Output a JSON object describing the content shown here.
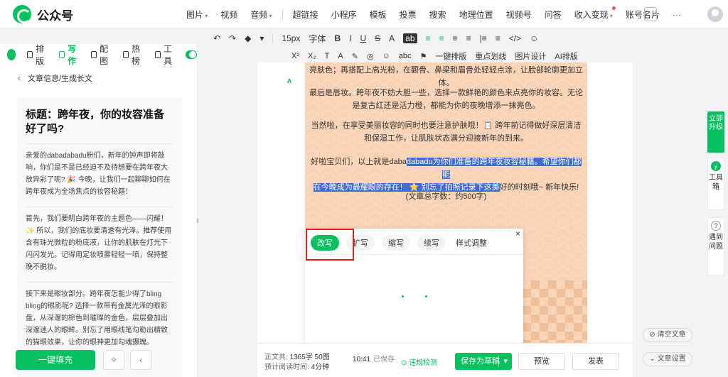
{
  "app": {
    "name": "公众号"
  },
  "topnav": [
    "图片",
    "视频",
    "音频",
    "超链接",
    "小程序",
    "模板",
    "投票",
    "搜索",
    "地理位置",
    "视频号",
    "问答",
    "收入变现",
    "账号名片",
    "···"
  ],
  "toolbar1": [
    "↶",
    "↷",
    "◆",
    "▾",
    "15px",
    "字体",
    "B",
    "I",
    "U",
    "S",
    "A",
    "ab",
    "≡",
    "≡",
    "≡",
    "≡",
    "|≡",
    "≡",
    "</>",
    "☺"
  ],
  "toolbar2": [
    "X²",
    "X₂",
    "T",
    "A",
    "✎",
    "◎",
    "☺",
    "abc",
    "⚑",
    "一键排版",
    "重点划线",
    "图片设计",
    "AI排版"
  ],
  "leftpanel": {
    "tabs": [
      "排版",
      "写作",
      "配图",
      "热榜",
      "工具"
    ],
    "crumb": "文章信息/生成长文",
    "title": "标题：跨年夜，你的妆容准备好了吗?",
    "paras": [
      "亲爱的dabadabadu粉们，新年的钟声即将敲响，你们是不是已经迫不及待想要在跨年夜大放异彩了呢? 🎉 今晚，让我们一起聊聊如何在跨年夜成为全场焦点的妆容秘籍！",
      "首先，我们要明白跨年夜的主题色——闪耀！✨ 所以，我们的底妆要清透有光泽。推荐使用含有珠光微粒的粉底液，让你的肌肤在灯光下闪闪发光。记得用定妆喷雾轻轻一喷，保持整晚不脱妆。",
      "接下来是眼妆部分。跨年夜怎能少得了bling bling的眼影呢? 选择一款带有金属光泽的眼影盘，从深邃的棕色到璀璨的金色，层层叠加出深邃迷人的眼眸。别忘了用眼线笔勾勒出精致的猫眼效果，让你的眼神更加勾魂摄魄。"
    ],
    "fill_button": "一键填充"
  },
  "article": {
    "line1": "亮肤色；再搭配上高光粉，在颧骨、鼻梁和眉骨处轻轻点涂，让脸部轮廓更加立体。",
    "para_lip": "最后是唇妆。跨年夜不妨大胆一些，选择一款鲜艳的颜色来点亮你的妆容。无论是复古红还是活力橙，都能为你的夜晚增添一抹亮色。",
    "para_care": "当然啦，在享受美丽妆容的同时也要注意护肤哦！📋 跨年前记得做好深层清洁和保湿工作，让肌肤状态满分迎接新年的到来。",
    "closing_before": "好啦宝贝们，以上就是daba",
    "closing_hl1": "dabadu为你们准备的跨年夜妆容秘籍。希望你们都能",
    "closing_hl2": "在今晚成为最耀眼的存在！ ⭐ 别忘了拍照记录下这美",
    "closing_after": "好的时刻哦~ 新年快乐!",
    "word_count": "(文章总字数：约500字)"
  },
  "popup": {
    "tabs": [
      "改写",
      "扩写",
      "缩写",
      "续写"
    ],
    "style": "样式调整",
    "close": "×"
  },
  "status": {
    "body_label": "正文共:",
    "body_value": "1365字 50图",
    "read_label": "预计阅读时间:",
    "read_value": "4分钟",
    "time": "10:41",
    "saved": "已保存",
    "check": "违规检测",
    "save_draft": "保存为草稿",
    "preview": "预览",
    "publish": "发表"
  },
  "rightside": {
    "upgrade": "立即升级",
    "toolbox": "工具箱",
    "help": "遇到问题",
    "clear": "清空文章",
    "settings": "文章设置"
  }
}
